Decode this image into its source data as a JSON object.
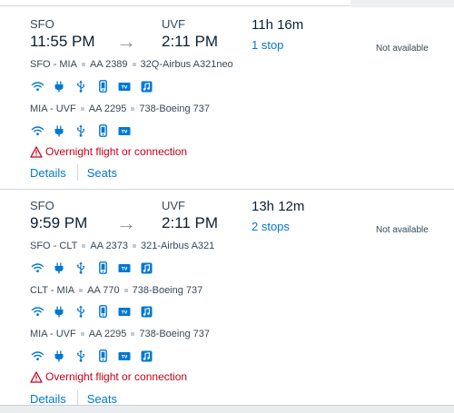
{
  "colors": {
    "link": "#0078d2",
    "warning": "#c30019",
    "icon": "#0078d2",
    "text": "#36495a"
  },
  "flights": [
    {
      "origin": "SFO",
      "destination": "UVF",
      "depart_time": "11:55 PM",
      "arrive_time": "2:11 PM",
      "arrow": "→",
      "duration": "11h 16m",
      "stops": "1 stop",
      "availability": "Not available",
      "segments": [
        {
          "route": "SFO - MIA",
          "flight": "AA 2389",
          "aircraft": "32Q-Airbus A321neo",
          "amenities": [
            "wifi-icon",
            "power-outlet-icon",
            "usb-icon",
            "phone-icon",
            "tv-icon",
            "music-icon"
          ]
        },
        {
          "route": "MIA - UVF",
          "flight": "AA 2295",
          "aircraft": "738-Boeing 737",
          "amenities": [
            "wifi-icon",
            "power-outlet-icon",
            "usb-icon",
            "phone-icon",
            "tv-icon"
          ]
        }
      ],
      "warning": "Overnight flight or connection",
      "details_label": "Details",
      "seats_label": "Seats"
    },
    {
      "origin": "SFO",
      "destination": "UVF",
      "depart_time": "9:59 PM",
      "arrive_time": "2:11 PM",
      "arrow": "→",
      "duration": "13h 12m",
      "stops": "2 stops",
      "availability": "Not available",
      "segments": [
        {
          "route": "SFO - CLT",
          "flight": "AA 2373",
          "aircraft": "321-Airbus A321",
          "amenities": [
            "wifi-icon",
            "power-outlet-icon",
            "usb-icon",
            "phone-icon",
            "tv-icon",
            "music-icon"
          ]
        },
        {
          "route": "CLT - MIA",
          "flight": "AA 770",
          "aircraft": "738-Boeing 737",
          "amenities": [
            "wifi-icon",
            "power-outlet-icon",
            "usb-icon",
            "phone-icon",
            "tv-icon",
            "music-icon"
          ]
        },
        {
          "route": "MIA - UVF",
          "flight": "AA 2295",
          "aircraft": "738-Boeing 737",
          "amenities": [
            "wifi-icon",
            "power-outlet-icon",
            "usb-icon",
            "phone-icon",
            "tv-icon",
            "music-icon"
          ]
        }
      ],
      "warning": "Overnight flight or connection",
      "details_label": "Details",
      "seats_label": "Seats"
    }
  ]
}
